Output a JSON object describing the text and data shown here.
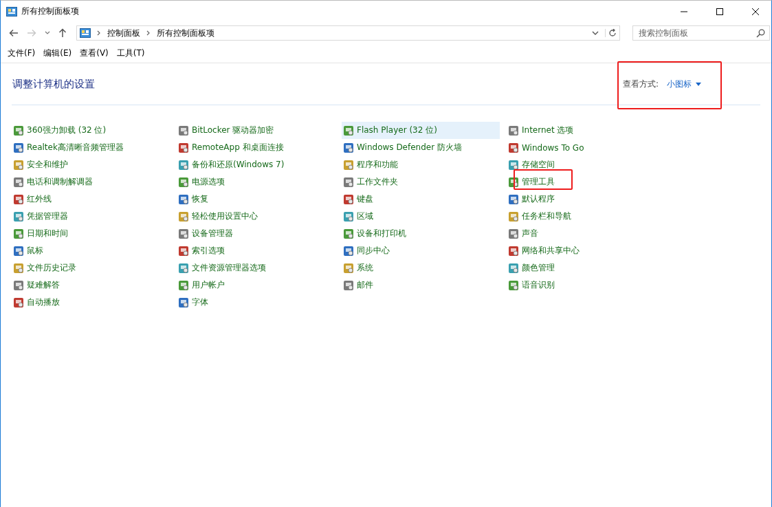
{
  "window": {
    "title": "所有控制面板项"
  },
  "nav": {
    "breadcrumbs": [
      "控制面板",
      "所有控制面板项"
    ],
    "search_placeholder": "搜索控制面板"
  },
  "menu": [
    "文件(F)",
    "编辑(E)",
    "查看(V)",
    "工具(T)"
  ],
  "header": {
    "title": "调整计算机的设置",
    "view_label": "查看方式:",
    "view_value": "小图标",
    "annotated": true
  },
  "columns": [
    [
      {
        "label": "360强力卸载 (32 位)",
        "highlighted": false,
        "annotated": false
      },
      {
        "label": "Realtek高清晰音频管理器",
        "highlighted": false,
        "annotated": false
      },
      {
        "label": "安全和维护",
        "highlighted": false,
        "annotated": false
      },
      {
        "label": "电话和调制解调器",
        "highlighted": false,
        "annotated": false
      },
      {
        "label": "红外线",
        "highlighted": false,
        "annotated": false
      },
      {
        "label": "凭据管理器",
        "highlighted": false,
        "annotated": false
      },
      {
        "label": "日期和时间",
        "highlighted": false,
        "annotated": false
      },
      {
        "label": "鼠标",
        "highlighted": false,
        "annotated": false
      },
      {
        "label": "文件历史记录",
        "highlighted": false,
        "annotated": false
      },
      {
        "label": "疑难解答",
        "highlighted": false,
        "annotated": false
      },
      {
        "label": "自动播放",
        "highlighted": false,
        "annotated": false
      }
    ],
    [
      {
        "label": "BitLocker 驱动器加密",
        "highlighted": false,
        "annotated": false
      },
      {
        "label": "RemoteApp 和桌面连接",
        "highlighted": false,
        "annotated": false
      },
      {
        "label": "备份和还原(Windows 7)",
        "highlighted": false,
        "annotated": false
      },
      {
        "label": "电源选项",
        "highlighted": false,
        "annotated": false
      },
      {
        "label": "恢复",
        "highlighted": false,
        "annotated": false
      },
      {
        "label": "轻松使用设置中心",
        "highlighted": false,
        "annotated": false
      },
      {
        "label": "设备管理器",
        "highlighted": false,
        "annotated": false
      },
      {
        "label": "索引选项",
        "highlighted": false,
        "annotated": false
      },
      {
        "label": "文件资源管理器选项",
        "highlighted": false,
        "annotated": false
      },
      {
        "label": "用户帐户",
        "highlighted": false,
        "annotated": false
      },
      {
        "label": "字体",
        "highlighted": false,
        "annotated": false
      }
    ],
    [
      {
        "label": "Flash Player (32 位)",
        "highlighted": true,
        "annotated": false
      },
      {
        "label": "Windows Defender 防火墙",
        "highlighted": false,
        "annotated": false
      },
      {
        "label": "程序和功能",
        "highlighted": false,
        "annotated": false
      },
      {
        "label": "工作文件夹",
        "highlighted": false,
        "annotated": false
      },
      {
        "label": "键盘",
        "highlighted": false,
        "annotated": false
      },
      {
        "label": "区域",
        "highlighted": false,
        "annotated": false
      },
      {
        "label": "设备和打印机",
        "highlighted": false,
        "annotated": false
      },
      {
        "label": "同步中心",
        "highlighted": false,
        "annotated": false
      },
      {
        "label": "系统",
        "highlighted": false,
        "annotated": false
      },
      {
        "label": "邮件",
        "highlighted": false,
        "annotated": false
      }
    ],
    [
      {
        "label": "Internet 选项",
        "highlighted": false,
        "annotated": false
      },
      {
        "label": "Windows To Go",
        "highlighted": false,
        "annotated": false
      },
      {
        "label": "存储空间",
        "highlighted": false,
        "annotated": false
      },
      {
        "label": "管理工具",
        "highlighted": false,
        "annotated": true
      },
      {
        "label": "默认程序",
        "highlighted": false,
        "annotated": false
      },
      {
        "label": "任务栏和导航",
        "highlighted": false,
        "annotated": false
      },
      {
        "label": "声音",
        "highlighted": false,
        "annotated": false
      },
      {
        "label": "网络和共享中心",
        "highlighted": false,
        "annotated": false
      },
      {
        "label": "颜色管理",
        "highlighted": false,
        "annotated": false
      },
      {
        "label": "语音识别",
        "highlighted": false,
        "annotated": false
      }
    ]
  ]
}
